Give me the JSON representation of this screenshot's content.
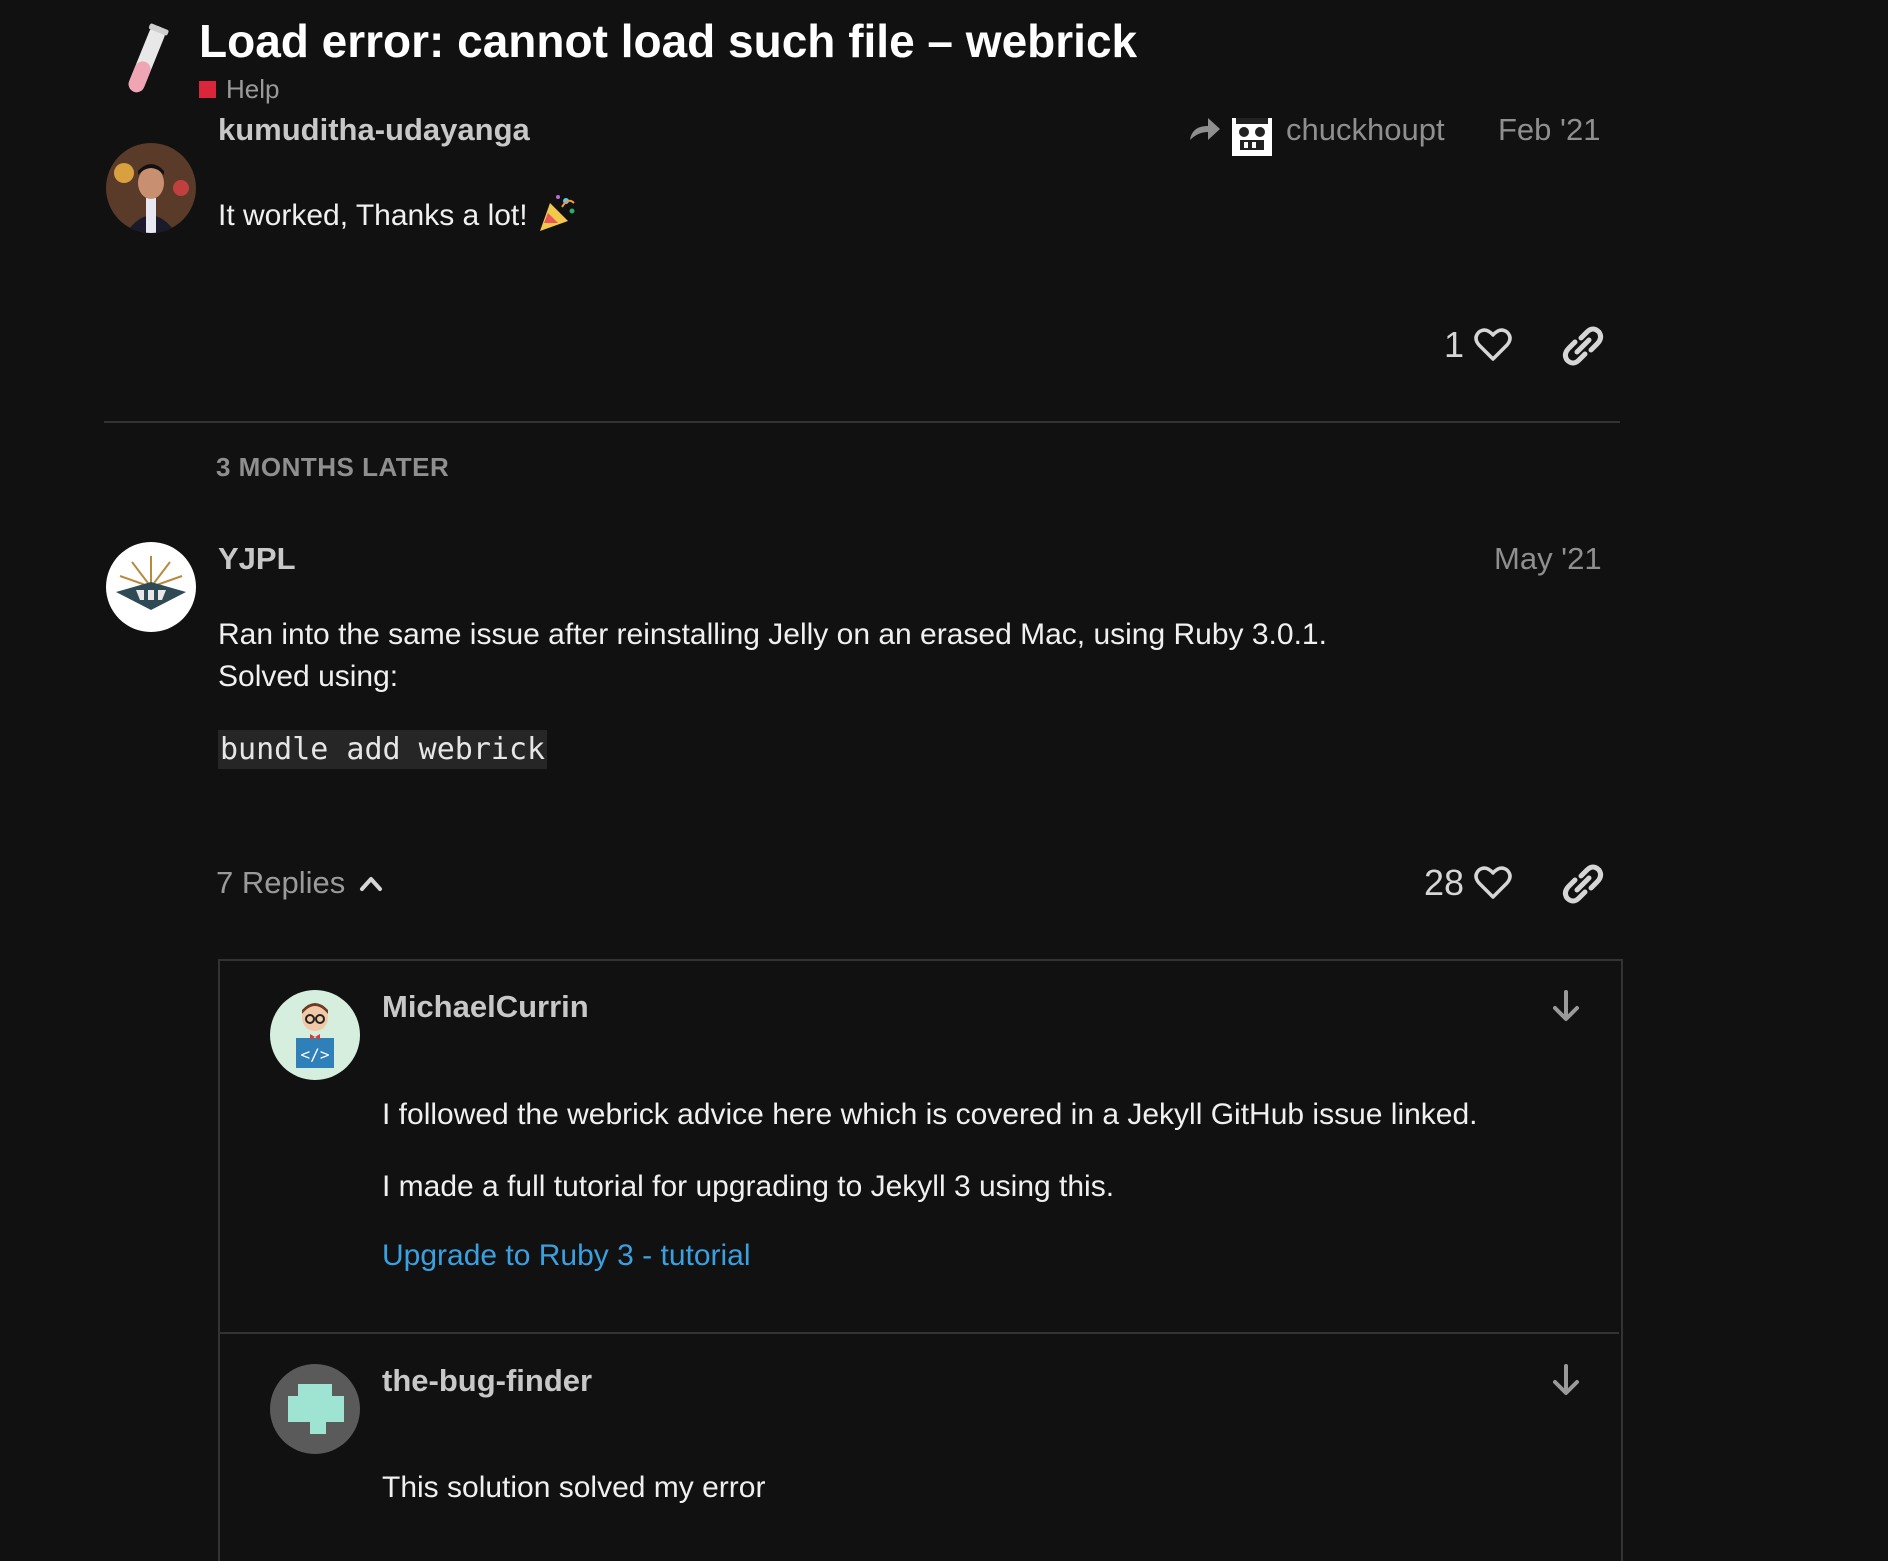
{
  "header": {
    "title": "Load error: cannot load such file – webrick",
    "category": "Help",
    "category_color": "#d9263a",
    "logo_icon": "test-tube-icon"
  },
  "post1": {
    "username": "kumuditha-udayanga",
    "reply_to": "chuckhoupt",
    "date": "Feb '21",
    "body": "It worked, Thanks a lot!",
    "emoji": "party-popper-icon",
    "likes": "1"
  },
  "time_gap": "3 MONTHS LATER",
  "post2": {
    "username": "YJPL",
    "date": "May '21",
    "body_line1": "Ran into the same issue after reinstalling Jelly on an erased Mac, using Ruby 3.0.1.",
    "body_line2": "Solved using:",
    "code": "bundle add webrick",
    "replies_label": "7 Replies",
    "likes": "28"
  },
  "replies": [
    {
      "username": "MichaelCurrin",
      "para1": "I followed the webrick advice here which is covered in a Jekyll GitHub issue linked.",
      "para2": "I made a full tutorial for upgrading to Jekyll 3 using this.",
      "link_text": "Upgrade to Ruby 3 - tutorial"
    },
    {
      "username": "the-bug-finder",
      "para1": "This solution solved my error"
    }
  ],
  "colors": {
    "background": "#111111",
    "link": "#3aa0e0",
    "muted": "#8f8f8f"
  }
}
